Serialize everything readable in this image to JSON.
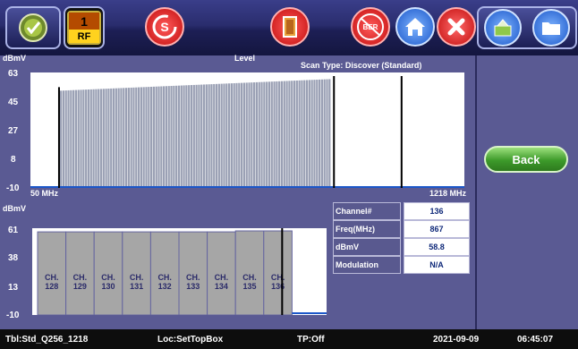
{
  "toolbar": {
    "rf_number": "1",
    "rf_label": "RF",
    "scan_icon_letter": "S",
    "ber_label": "BER",
    "icons": [
      "check-mode-icon",
      "rf-port-icon",
      "scan-icon",
      "exit-door-icon",
      "ber-icon",
      "home-icon",
      "close-icon",
      "save-icon",
      "folder-icon"
    ]
  },
  "upper_chart": {
    "unit": "dBmV",
    "title": "Level",
    "scan_type": "Scan Type: Discover (Standard)",
    "y_ticks": [
      "63",
      "45",
      "27",
      "8",
      "-10"
    ],
    "x_start": "50 MHz",
    "x_end": "1218 MHz"
  },
  "lower_chart": {
    "unit": "dBmV",
    "y_ticks": [
      "61",
      "38",
      "13",
      "-10"
    ],
    "channels": [
      "CH. 128",
      "CH. 129",
      "CH. 130",
      "CH. 131",
      "CH. 132",
      "CH. 133",
      "CH. 134",
      "CH. 135",
      "CH. 136"
    ]
  },
  "info": [
    {
      "key": "Channel#",
      "value": "136"
    },
    {
      "key": "Freq(MHz)",
      "value": "867"
    },
    {
      "key": "dBmV",
      "value": "58.8"
    },
    {
      "key": "Modulation",
      "value": "N/A"
    }
  ],
  "side": {
    "back_label": "Back"
  },
  "status": {
    "table": "Tbl:Std_Q256_1218",
    "location": "Loc:SetTopBox",
    "tp": "TP:Off",
    "date": "2021-09-09",
    "time": "06:45:07"
  },
  "chart_data": [
    {
      "type": "bar",
      "title": "Level",
      "ylabel": "dBmV",
      "ylim": [
        -10,
        63
      ],
      "x_range_mhz": [
        50,
        1218
      ],
      "series": [
        {
          "values_start": 51.5,
          "values_end": 58.8,
          "bar_count": 108
        }
      ],
      "markers_mhz": [
        127,
        867,
        1049
      ]
    },
    {
      "type": "bar",
      "ylabel": "dBmV",
      "ylim": [
        -10,
        61
      ],
      "categories": [
        "CH. 128",
        "CH. 129",
        "CH. 130",
        "CH. 131",
        "CH. 132",
        "CH. 133",
        "CH. 134",
        "CH. 135",
        "CH. 136"
      ],
      "values": [
        58.0,
        58.0,
        58.0,
        58.0,
        58.0,
        58.0,
        58.0,
        58.8,
        58.8
      ]
    }
  ]
}
